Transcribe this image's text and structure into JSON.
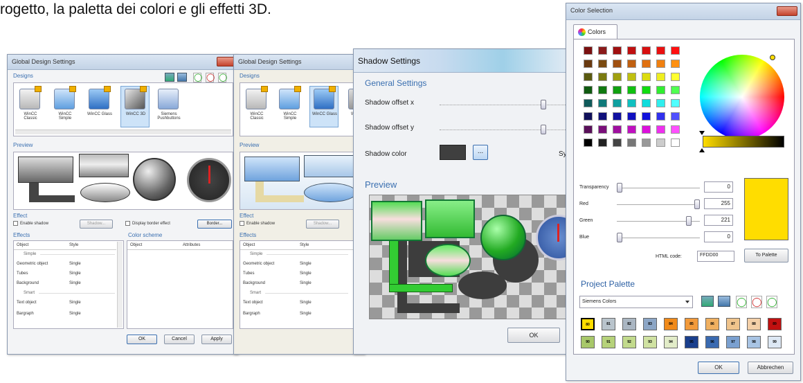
{
  "caption": "rogetto, la paletta dei colori e gli effetti 3D.",
  "gds1": {
    "title": "Global Design Settings",
    "designs_label": "Designs",
    "designs": [
      "WinCC Classic",
      "WinCC Simple",
      "WinCC Glass",
      "WinCC 3D",
      "Siemens Pushbuttons"
    ],
    "preview_label": "Preview",
    "effect_label": "Effect",
    "enable_shadow": "Enable shadow",
    "shadow_btn": "Shadow...",
    "display_border_effect": "Display border effect",
    "border_btn": "Border...",
    "effects_label": "Effects",
    "effects_cols": [
      "Object",
      "Style"
    ],
    "effects_rows": [
      [
        "Simple",
        ""
      ],
      [
        "Geometric object",
        "Single"
      ],
      [
        "Tubes",
        "Single"
      ],
      [
        "Background",
        "Single"
      ],
      [
        "Smart",
        ""
      ],
      [
        "Text object",
        "Single"
      ],
      [
        "Bargraph",
        "Single"
      ]
    ],
    "color_scheme_label": "Color scheme",
    "color_cols": [
      "Object",
      "Attributes"
    ],
    "ok": "OK",
    "cancel": "Cancel",
    "apply": "Apply"
  },
  "gds2": {
    "title": "Global Design Settings",
    "designs_label": "Designs",
    "designs": [
      "WinCC Classic",
      "WinCC Simple",
      "WinCC Glass",
      "Wi"
    ],
    "preview_label": "Preview",
    "effect_label": "Effect",
    "enable_shadow": "Enable shadow",
    "shadow_btn": "Shadow...",
    "effects_label": "Effects",
    "effects_cols": [
      "Object",
      "Style"
    ],
    "effects_rows": [
      [
        "Simple",
        ""
      ],
      [
        "Geometric object",
        "Single"
      ],
      [
        "Tubes",
        "Single"
      ],
      [
        "Background",
        "Single"
      ],
      [
        "Smart",
        ""
      ],
      [
        "Text object",
        "Single"
      ],
      [
        "Bargraph",
        "Single"
      ]
    ]
  },
  "shadow": {
    "title": "Shadow Settings",
    "general": "General Settings",
    "offset_x": "Shadow offset x",
    "offset_y": "Shadow offset y",
    "color": "Shadow color",
    "color_btn": "...",
    "sy": "Sy",
    "preview": "Preview",
    "ok": "OK"
  },
  "colorsel": {
    "title": "Color Selection",
    "tab": "Colors",
    "transparency": "Transparency",
    "transparency_val": "0",
    "red": "Red",
    "red_val": "255",
    "green": "Green",
    "green_val": "221",
    "blue": "Blue",
    "blue_val": "0",
    "html_label": "HTML code:",
    "html_val": "FFDD00",
    "to_palette": "To Palette",
    "project_palette": "Project Palette",
    "palette_select": "Siemens Colors",
    "palette_row1": [
      "80",
      "81",
      "82",
      "83",
      "84",
      "85",
      "86",
      "87",
      "88",
      "89"
    ],
    "palette_row2": [
      "90",
      "91",
      "92",
      "93",
      "94",
      "95",
      "96",
      "97",
      "98",
      "99"
    ],
    "ok": "OK",
    "abbrechen": "Abbrechen",
    "accent": "#FFDD00"
  }
}
